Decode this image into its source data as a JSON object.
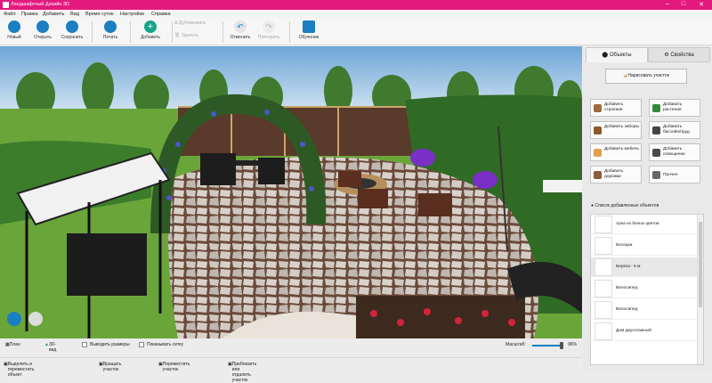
{
  "title_bar": {
    "title": "Ландшафтный Дизайн 3D",
    "minimize": "–",
    "maximize": "□",
    "close": "✕"
  },
  "menu": [
    "Файл",
    "Правка",
    "Добавить",
    "Вид",
    "Время суток",
    "Настройки",
    "Справка"
  ],
  "toolbar": {
    "new": "Новый",
    "open": "Открыть",
    "save": "Сохранить",
    "print": "Печать",
    "add": "Добавить",
    "duplicate": "Дублировать",
    "delete": "Удалить",
    "undo": "Отменить",
    "redo": "Повторить",
    "tutorial": "Обучение"
  },
  "panel": {
    "tab_objects": "Объекты",
    "tab_properties": "Свойства",
    "draw_plot": "Нарисовать участок",
    "add_buttons": [
      {
        "label": "Добавить строения",
        "icon": "building-icon",
        "color": "#9b6a3d"
      },
      {
        "label": "Добавить растения",
        "icon": "plant-icon",
        "color": "#2e8b3a"
      },
      {
        "label": "Добавить заборы",
        "icon": "fence-icon",
        "color": "#8a5a2b"
      },
      {
        "label": "Добавить бассейн/пруд",
        "icon": "pool-icon",
        "color": "#444444"
      },
      {
        "label": "Добавить мебель",
        "icon": "furniture-icon",
        "color": "#e0a04d"
      },
      {
        "label": "Добавить освещение",
        "icon": "lamp-icon",
        "color": "#4a4a4a"
      },
      {
        "label": "Добавить дорожки",
        "icon": "path-icon",
        "color": "#8b5a3a"
      },
      {
        "label": "Прочее",
        "icon": "misc-icon",
        "color": "#666666"
      }
    ],
    "list_title": "Список добавленных объектов",
    "list_items": [
      {
        "label": "Арка из белых цветов",
        "icon": "arch-icon"
      },
      {
        "label": "Беседка",
        "icon": "gazebo-icon"
      },
      {
        "label": "Береза - 6 м",
        "icon": "birch-icon"
      },
      {
        "label": "Велосипед",
        "icon": "bicycle-icon"
      },
      {
        "label": "Велосипед",
        "icon": "bicycle-icon"
      },
      {
        "label": "Дом двухэтажный",
        "icon": "house-icon"
      }
    ]
  },
  "view_bar": {
    "plan": "План",
    "view3d": "3D-вид",
    "show_sizes": "Выводить размеры",
    "show_grid": "Показывать сетку",
    "zoom_label": "Масштаб:",
    "zoom_value": "96%",
    "zoom_fraction": 0.96
  },
  "status_bar": {
    "hint1": "Выделить и переместить объект",
    "hint2": "Вращать участок",
    "hint3": "Переместить участок",
    "hint4": "Приблизить или отдалить участок"
  }
}
